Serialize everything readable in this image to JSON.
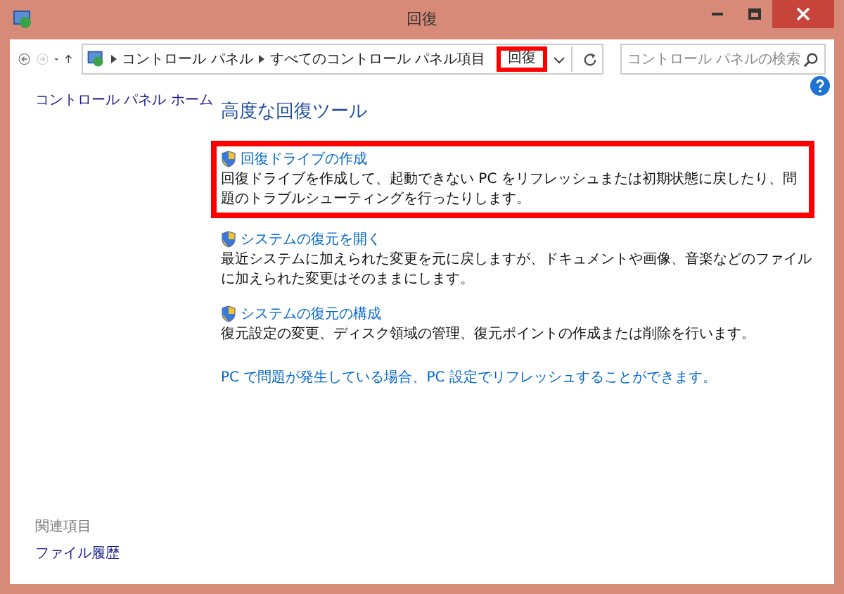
{
  "window": {
    "title": "回復"
  },
  "address_bar": {
    "breadcrumbs": [
      {
        "label": "コントロール パネル",
        "highlighted": false
      },
      {
        "label": "すべてのコントロール パネル項目",
        "highlighted": false
      },
      {
        "label": "回復",
        "highlighted": true
      }
    ],
    "search_placeholder": "コントロール パネルの検索"
  },
  "sidebar": {
    "home_link": "コントロール パネル ホーム",
    "related_heading": "関連項目",
    "related_links": [
      "ファイル履歴"
    ]
  },
  "main": {
    "heading": "高度な回復ツール",
    "tools": [
      {
        "title": "回復ドライブの作成",
        "description": "回復ドライブを作成して、起動できない PC をリフレッシュまたは初期状態に戻したり、問題のトラブルシューティングを行ったりします。",
        "highlighted": true
      },
      {
        "title": "システムの復元を開く",
        "description": "最近システムに加えられた変更を元に戻しますが、ドキュメントや画像、音楽などのファイルに加えられた変更はそのままにします。",
        "highlighted": false
      },
      {
        "title": "システムの復元の構成",
        "description": "復元設定の変更、ディスク領域の管理、復元ポイントの作成または削除を行います。",
        "highlighted": false
      }
    ],
    "footer_link": "PC で問題が発生している場合、PC 設定でリフレッシュすることができます。"
  }
}
